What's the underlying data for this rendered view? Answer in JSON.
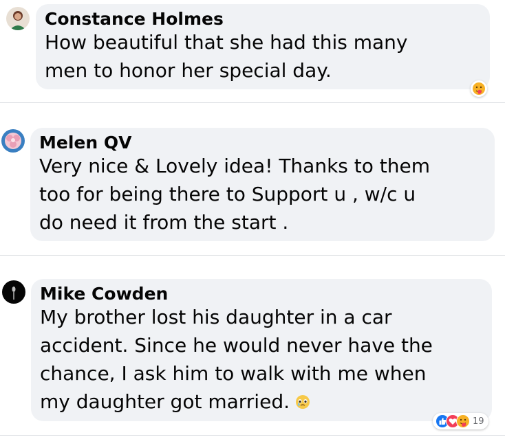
{
  "comments": [
    {
      "author": "Constance Holmes",
      "text": "How beautiful that she had this many\nmen to honor her special day.",
      "reactions": [
        "care-react-icon"
      ],
      "reaction_count": ""
    },
    {
      "author": "Melen QV",
      "text": "Very nice & Lovely idea! Thanks to them\ntoo for being there to Support u , w/c u\ndo need it from the start .",
      "reactions": [],
      "reaction_count": ""
    },
    {
      "author": "Mike Cowden",
      "text": "My brother lost his daughter in a car\naccident. Since he would never have the\nchance, I ask him to walk with me when\nmy daughter got married.",
      "inline_emoji": "teary-eyes-emoji-icon",
      "reactions": [
        "like-react-icon",
        "love-react-icon",
        "care-react-icon"
      ],
      "reaction_count": "19"
    }
  ],
  "colors": {
    "bubble": "#f0f2f5",
    "text": "#050505",
    "like_blue": "#1877f2",
    "love_red": "#f33e58",
    "care_yellow": "#f7b125"
  }
}
